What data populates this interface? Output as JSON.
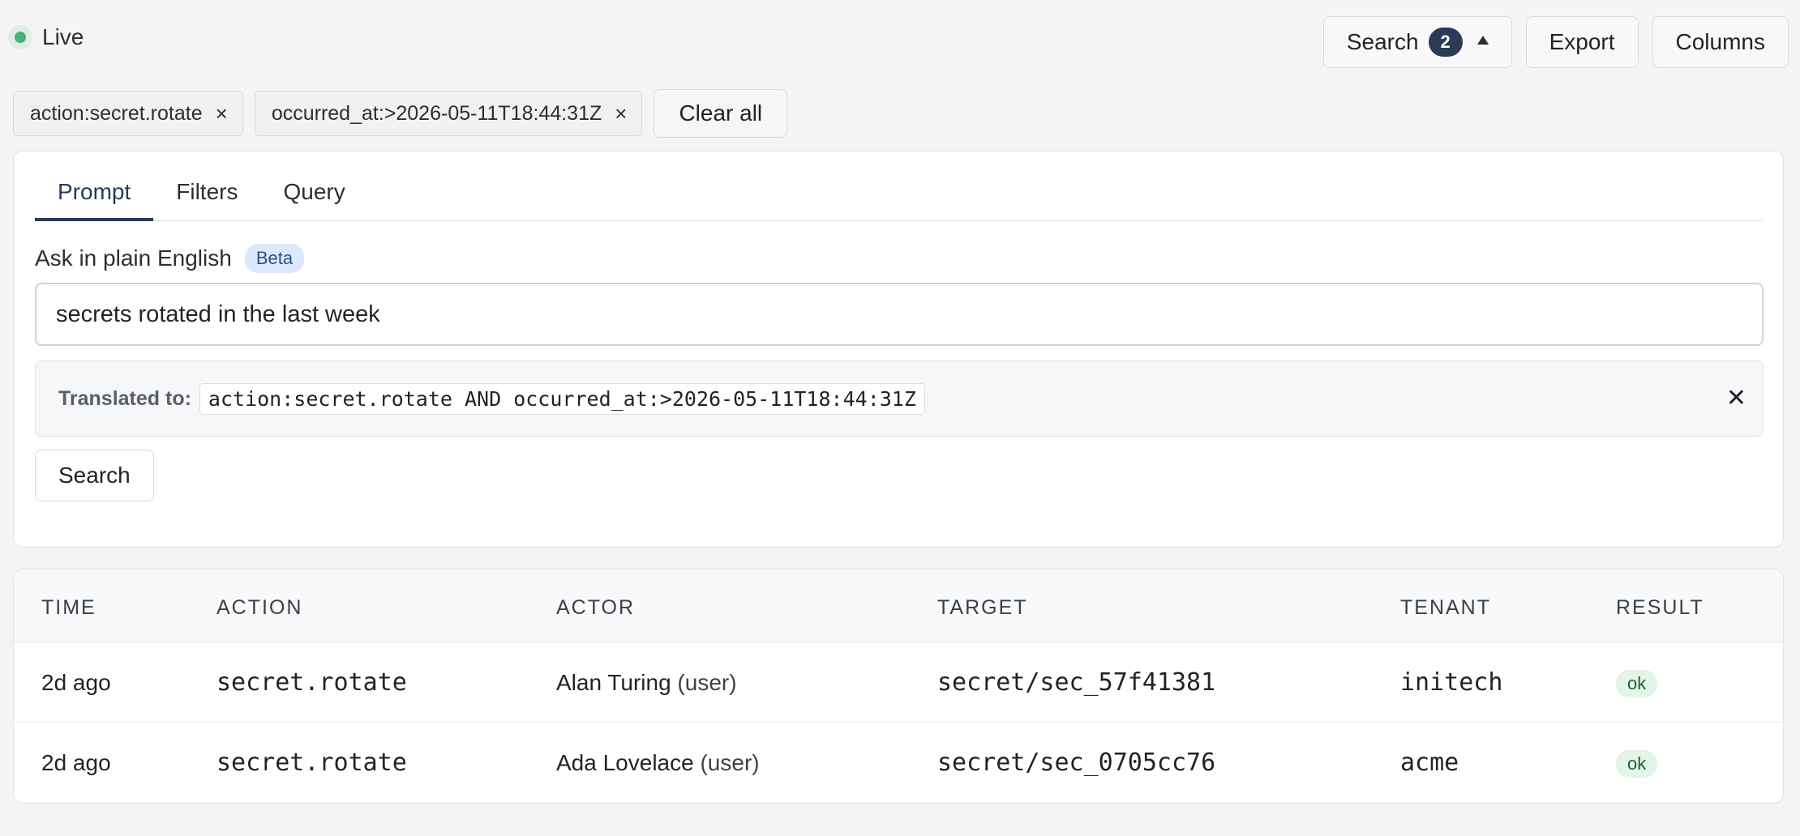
{
  "status": {
    "label": "Live"
  },
  "toolbar": {
    "search_label": "Search",
    "search_count": "2",
    "export_label": "Export",
    "columns_label": "Columns"
  },
  "filters": {
    "chips": [
      {
        "label": "action:secret.rotate"
      },
      {
        "label": "occurred_at:>2026-05-11T18:44:31Z"
      }
    ],
    "remove_glyph": "×",
    "clear_all_label": "Clear all"
  },
  "panel": {
    "tabs": [
      {
        "label": "Prompt",
        "active": true
      },
      {
        "label": "Filters",
        "active": false
      },
      {
        "label": "Query",
        "active": false
      }
    ],
    "ask_label": "Ask in plain English",
    "beta_label": "Beta",
    "prompt_value": "secrets rotated in the last week",
    "translated_label": "Translated to:",
    "translated_query": "action:secret.rotate AND occurred_at:>2026-05-11T18:44:31Z",
    "close_glyph": "✕",
    "search_button_label": "Search"
  },
  "table": {
    "headers": [
      "TIME",
      "ACTION",
      "ACTOR",
      "TARGET",
      "TENANT",
      "RESULT"
    ],
    "rows": [
      {
        "time": "2d ago",
        "action": "secret.rotate",
        "actor_name": "Alan Turing",
        "actor_type": "(user)",
        "target": "secret/sec_57f41381",
        "tenant": "initech",
        "result": "ok"
      },
      {
        "time": "2d ago",
        "action": "secret.rotate",
        "actor_name": "Ada Lovelace",
        "actor_type": "(user)",
        "target": "secret/sec_0705cc76",
        "tenant": "acme",
        "result": "ok"
      }
    ]
  },
  "colors": {
    "live": "#4caf7a",
    "accent": "#253a5a",
    "badge": "#2b3a55",
    "beta_bg": "#dce8fb",
    "ok_bg": "#e3f5e8"
  }
}
